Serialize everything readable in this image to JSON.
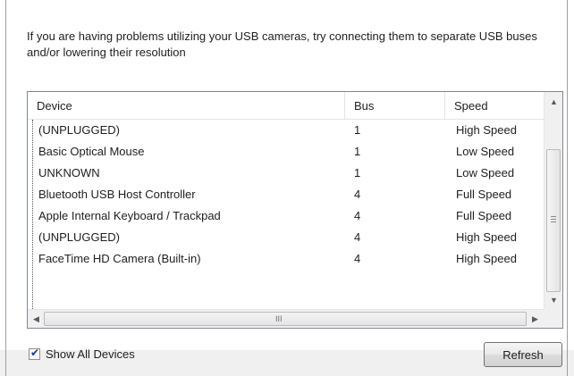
{
  "info_text": "If you are having problems utilizing your USB cameras, try connecting them to separate USB buses and/or lowering their resolution",
  "device_list": {
    "columns": [
      "Device",
      "Bus",
      "Speed"
    ],
    "rows": [
      [
        "(UNPLUGGED)",
        "1",
        "High Speed"
      ],
      [
        "Basic Optical Mouse",
        "1",
        "Low Speed"
      ],
      [
        "UNKNOWN",
        "1",
        "Low Speed"
      ],
      [
        "Bluetooth USB Host Controller",
        "4",
        "Full Speed"
      ],
      [
        "Apple Internal Keyboard / Trackpad",
        "4",
        "Full Speed"
      ],
      [
        "(UNPLUGGED)",
        "4",
        "High Speed"
      ],
      [
        "FaceTime HD Camera (Built-in)",
        "4",
        "High Speed"
      ]
    ],
    "hscroll_grip_text": "III"
  },
  "show_all_devices": {
    "label": "Show All Devices",
    "checked": true
  },
  "refresh_button": {
    "label": "Refresh"
  },
  "icons": {
    "scroll_up": "triangle-up",
    "scroll_down": "triangle-down",
    "scroll_left": "triangle-left",
    "scroll_right": "triangle-right"
  }
}
